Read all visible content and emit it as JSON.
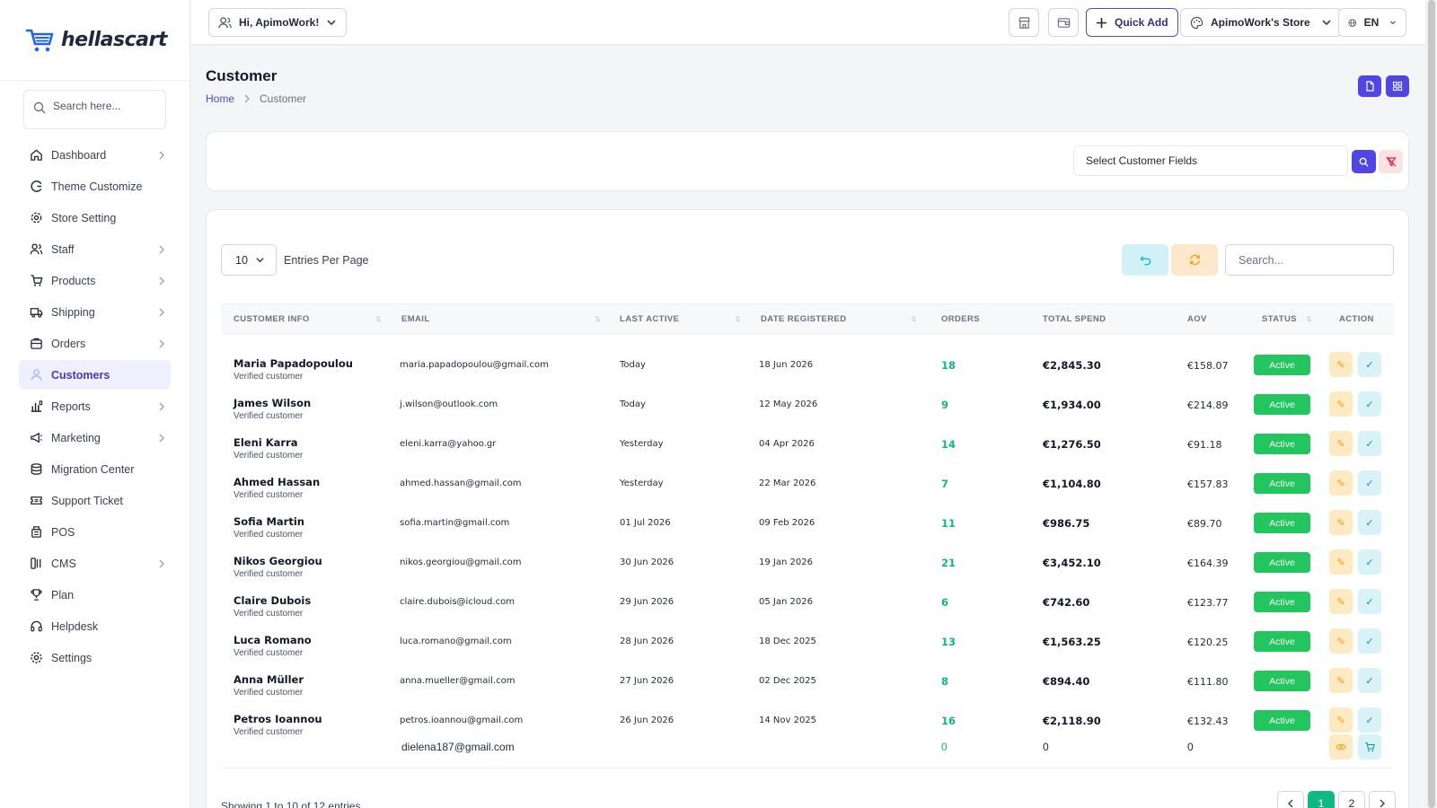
{
  "app": {
    "logo": "hellascart",
    "brand_color": "#4f46e5"
  },
  "sidebar": {
    "search_placeholder": "Search here...",
    "items": [
      {
        "label": "Dashboard",
        "icon": "home-icon",
        "chevron": true
      },
      {
        "label": "Theme Customize",
        "icon": "palette-icon",
        "chevron": false
      },
      {
        "label": "Store Setting",
        "icon": "gear-icon",
        "chevron": false
      },
      {
        "label": "Staff",
        "icon": "users-icon",
        "chevron": true
      },
      {
        "label": "Products",
        "icon": "cart-icon",
        "chevron": true
      },
      {
        "label": "Shipping",
        "icon": "truck-icon",
        "chevron": true
      },
      {
        "label": "Orders",
        "icon": "box-icon",
        "chevron": true
      },
      {
        "label": "Customers",
        "icon": "user-icon",
        "chevron": false,
        "active": true
      },
      {
        "label": "Reports",
        "icon": "chart-icon",
        "chevron": true
      },
      {
        "label": "Marketing",
        "icon": "megaphone-icon",
        "chevron": true
      },
      {
        "label": "Migration Center",
        "icon": "database-icon",
        "chevron": false
      },
      {
        "label": "Support Ticket",
        "icon": "ticket-icon",
        "chevron": false
      },
      {
        "label": "POS",
        "icon": "register-icon",
        "chevron": false
      },
      {
        "label": "CMS",
        "icon": "layout-icon",
        "chevron": true
      },
      {
        "label": "Plan",
        "icon": "trophy-icon",
        "chevron": false
      },
      {
        "label": "Helpdesk",
        "icon": "headset-icon",
        "chevron": false
      },
      {
        "label": "Settings",
        "icon": "settings-icon",
        "chevron": false
      }
    ]
  },
  "topbar": {
    "greeting": "Hi, ApimoWork!",
    "quick_add": "Quick Add",
    "store": "ApimoWork's Store",
    "language": "EN"
  },
  "page": {
    "title": "Customer",
    "breadcrumb_home": "Home",
    "breadcrumb_current": "Customer"
  },
  "filter": {
    "select_label": "Select Customer Fields"
  },
  "table": {
    "entries_value": "10",
    "entries_label": "Entries Per Page",
    "search_placeholder": "Search...",
    "headers": [
      "CUSTOMER INFO",
      "EMAIL",
      "LAST ACTIVE",
      "DATE REGISTERED",
      "ORDERS",
      "TOTAL SPEND",
      "AOV",
      "STATUS",
      "ACTION"
    ],
    "rows": [
      {
        "name": "Maria Papadopoulou",
        "sub": "Verified customer",
        "email": "maria.papadopoulou@gmail.com",
        "last": "Today",
        "registered": "18 Jun 2026",
        "orders": "18",
        "spend": "€2,845.30",
        "aov": "€158.07",
        "status": "Active"
      },
      {
        "name": "James Wilson",
        "sub": "Verified customer",
        "email": "j.wilson@outlook.com",
        "last": "Today",
        "registered": "12 May 2026",
        "orders": "9",
        "spend": "€1,934.00",
        "aov": "€214.89",
        "status": "Active"
      },
      {
        "name": "Eleni Karra",
        "sub": "Verified customer",
        "email": "eleni.karra@yahoo.gr",
        "last": "Yesterday",
        "registered": "04 Apr 2026",
        "orders": "14",
        "spend": "€1,276.50",
        "aov": "€91.18",
        "status": "Active"
      },
      {
        "name": "Ahmed Hassan",
        "sub": "Verified customer",
        "email": "ahmed.hassan@gmail.com",
        "last": "Yesterday",
        "registered": "22 Mar 2026",
        "orders": "7",
        "spend": "€1,104.80",
        "aov": "€157.83",
        "status": "Active"
      },
      {
        "name": "Sofia Martin",
        "sub": "Verified customer",
        "email": "sofia.martin@gmail.com",
        "last": "01 Jul 2026",
        "registered": "09 Feb 2026",
        "orders": "11",
        "spend": "€986.75",
        "aov": "€89.70",
        "status": "Active"
      },
      {
        "name": "Nikos Georgiou",
        "sub": "Verified customer",
        "email": "nikos.georgiou@gmail.com",
        "last": "30 Jun 2026",
        "registered": "19 Jan 2026",
        "orders": "21",
        "spend": "€3,452.10",
        "aov": "€164.39",
        "status": "Active"
      },
      {
        "name": "Claire Dubois",
        "sub": "Verified customer",
        "email": "claire.dubois@icloud.com",
        "last": "29 Jun 2026",
        "registered": "05 Jan 2026",
        "orders": "6",
        "spend": "€742.60",
        "aov": "€123.77",
        "status": "Active"
      },
      {
        "name": "Luca Romano",
        "sub": "Verified customer",
        "email": "luca.romano@gmail.com",
        "last": "28 Jun 2026",
        "registered": "18 Dec 2025",
        "orders": "13",
        "spend": "€1,563.25",
        "aov": "€120.25",
        "status": "Active"
      },
      {
        "name": "Anna Müller",
        "sub": "Verified customer",
        "email": "anna.mueller@gmail.com",
        "last": "27 Jun 2026",
        "registered": "02 Dec 2025",
        "orders": "8",
        "spend": "€894.40",
        "aov": "€111.80",
        "status": "Active"
      },
      {
        "name": "Petros Ioannou",
        "sub": "Verified customer",
        "email": "petros.ioannou@gmail.com",
        "last": "26 Jun 2026",
        "registered": "14 Nov 2025",
        "orders": "16",
        "spend": "€2,118.90",
        "aov": "€132.43",
        "status": "Active"
      }
    ],
    "extra_row": {
      "email": "dielena187@gmail.com",
      "orders": "0",
      "spend": "0",
      "aov": "0"
    },
    "showing": "Showing 1 to 10 of 12 entries",
    "pages": [
      "1",
      "2"
    ]
  }
}
